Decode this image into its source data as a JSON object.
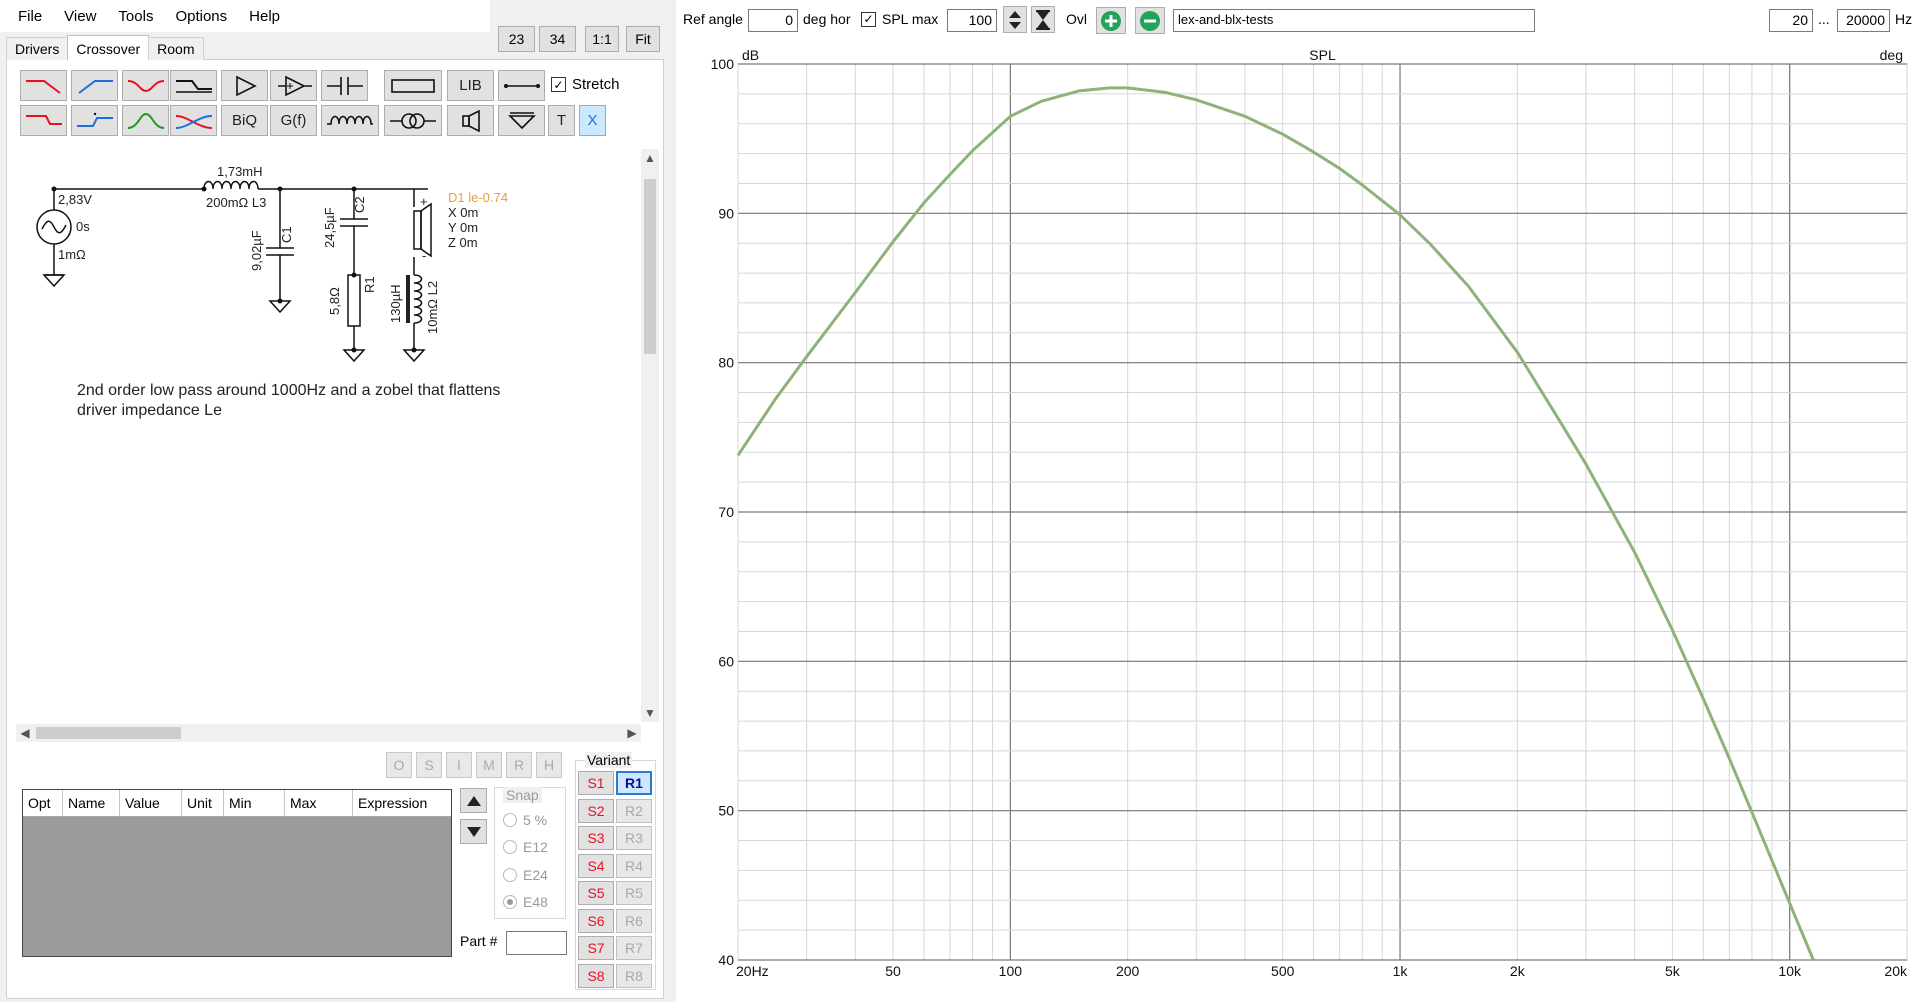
{
  "menu": [
    "File",
    "View",
    "Tools",
    "Options",
    "Help"
  ],
  "tabs": [
    "Drivers",
    "Crossover",
    "Room"
  ],
  "zoom_buttons": [
    "23",
    "34",
    "1:1",
    "Fit"
  ],
  "toolbar": {
    "lib_label": "LIB",
    "biq_label": "BiQ",
    "gf_label": "G(f)",
    "t_label": "T",
    "x_label": "X",
    "stretch_label": "Stretch",
    "stretch_checked": true
  },
  "schematic": {
    "source_voltage": "2,83V",
    "source_delay": "0s",
    "source_resistance": "1mΩ",
    "l3_value": "1,73mH",
    "l3_resistance": "200mΩ L3",
    "c1_value": "9,02µF",
    "c1_name": "C1",
    "c2_value": "24,5µF",
    "c2_name": "C2",
    "r1_value": "5,8Ω",
    "r1_name": "R1",
    "l2_value": "130µH",
    "l2_resistance": "10mΩ L2",
    "driver_label": "D1 le-0.74",
    "driver_x": "X 0m",
    "driver_y": "Y 0m",
    "driver_z": "Z 0m",
    "plus": "+",
    "minus": "-",
    "note": "2nd order low pass around 1000Hz and a zobel that flattens\ndriver impedance Le",
    "note_color": "#222222",
    "driver_label_color": "#e8a030"
  },
  "mini_buttons": [
    "O",
    "S",
    "I",
    "M",
    "R",
    "H"
  ],
  "param_table": {
    "columns": [
      "Opt",
      "Name",
      "Value",
      "Unit",
      "Min",
      "Max",
      "Expression"
    ]
  },
  "snap": {
    "label": "Snap",
    "options": [
      "5 %",
      "E12",
      "E24",
      "E48"
    ],
    "selected": "E48"
  },
  "part_label": "Part #",
  "part_value": "",
  "variant": {
    "label": "Variant",
    "s_buttons": [
      "S1",
      "S2",
      "S3",
      "S4",
      "S5",
      "S6",
      "S7",
      "S8"
    ],
    "r_buttons": [
      "R1",
      "R2",
      "R3",
      "R4",
      "R5",
      "R6",
      "R7",
      "R8"
    ],
    "selected": "R1"
  },
  "plot_toolbar": {
    "ref_angle_label": "Ref angle",
    "ref_angle_value": "0",
    "deg_hor_label": "deg hor",
    "spl_max_label": "SPL max",
    "spl_max_checked": true,
    "spl_max_value": "100",
    "ovl_label": "Ovl",
    "overlay_name": "lex-and-blx-tests",
    "freq_min": "20",
    "ellipsis": "...",
    "freq_max": "20000",
    "hz_label": "Hz"
  },
  "chart_data": {
    "type": "line",
    "title": "SPL",
    "xlabel": "",
    "ylabel_left": "dB",
    "ylabel_right": "deg",
    "x_scale": "log",
    "xlim": [
      20,
      20000
    ],
    "ylim": [
      40,
      100
    ],
    "y2lim": [
      -180,
      180
    ],
    "x_ticks": [
      20,
      50,
      100,
      200,
      500,
      1000,
      2000,
      5000,
      10000,
      20000
    ],
    "x_tick_labels": [
      "20Hz",
      "50",
      "100",
      "200",
      "500",
      "1k",
      "2k",
      "5k",
      "10k",
      "20k"
    ],
    "y_ticks": [
      40,
      50,
      60,
      70,
      80,
      90,
      100
    ],
    "y2_ticks": [
      -180,
      -120,
      -60,
      0,
      60,
      120,
      180
    ],
    "grid": true,
    "line_color": "#8db37a",
    "series": [
      {
        "x": [
          20,
          25,
          30,
          40,
          50,
          60,
          70,
          80,
          100,
          120,
          150,
          180,
          200,
          250,
          300,
          400,
          500,
          600,
          700,
          800,
          1000,
          1200,
          1500,
          2000,
          2500,
          3000,
          4000,
          5000,
          6000,
          7000,
          8000,
          10000,
          11500
        ],
        "values": [
          73.8,
          77.6,
          80.4,
          84.7,
          88.1,
          90.7,
          92.6,
          94.2,
          96.5,
          97.5,
          98.2,
          98.4,
          98.4,
          98.1,
          97.6,
          96.5,
          95.3,
          94.1,
          93.0,
          91.9,
          89.9,
          87.9,
          85.1,
          80.7,
          76.6,
          73.2,
          67.3,
          62.1,
          57.5,
          53.5,
          49.9,
          43.8,
          40.0
        ]
      }
    ]
  }
}
